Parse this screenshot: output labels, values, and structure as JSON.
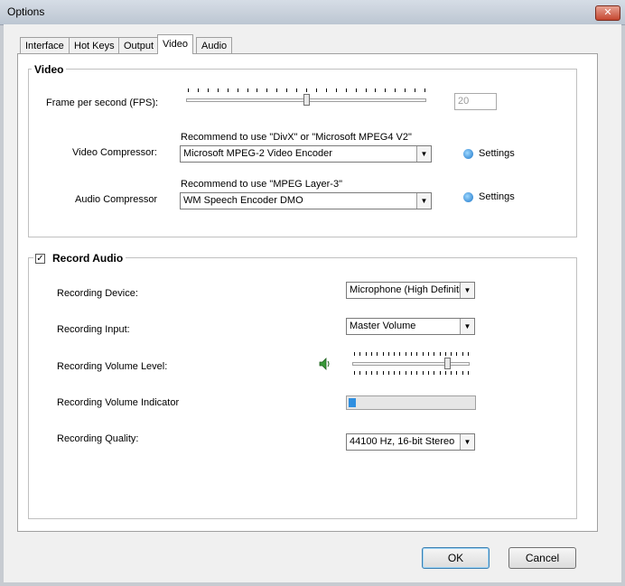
{
  "window": {
    "title": "Options",
    "close_glyph": "✕"
  },
  "tabs": [
    {
      "label": "Interface"
    },
    {
      "label": "Hot Keys"
    },
    {
      "label": "Output"
    },
    {
      "label": "Video"
    },
    {
      "label": "Audio"
    }
  ],
  "active_tab": "Video",
  "video_group": {
    "title": "Video",
    "fps_label": "Frame per second (FPS):",
    "fps_value": "20",
    "fps_slider_fraction": 0.5,
    "video_compressor_hint": "Recommend to use \"DivX\" or \"Microsoft MPEG4 V2\"",
    "video_compressor_label": "Video Compressor:",
    "video_compressor_value": "Microsoft MPEG-2 Video Encoder",
    "audio_compressor_hint": "Recommend to use \"MPEG Layer-3\"",
    "audio_compressor_label": "Audio Compressor",
    "audio_compressor_value": "WM Speech Encoder DMO",
    "settings_label": "Settings"
  },
  "audio_group": {
    "title": "Record Audio",
    "checked": true,
    "check_glyph": "✓",
    "recording_device_label": "Recording Device:",
    "recording_device_value": "Microphone (High Definitio",
    "recording_input_label": "Recording Input:",
    "recording_input_value": "Master Volume",
    "volume_level_label": "Recording Volume Level:",
    "volume_level_fraction": 0.82,
    "volume_indicator_label": "Recording Volume Indicator",
    "volume_indicator_fraction": 0.06,
    "quality_label": "Recording Quality:",
    "quality_value": "44100 Hz, 16-bit Stereo"
  },
  "buttons": {
    "ok": "OK",
    "cancel": "Cancel"
  },
  "icons": {
    "speaker": "speaker-icon",
    "settings": "settings-icon",
    "dropdown": "▼"
  }
}
